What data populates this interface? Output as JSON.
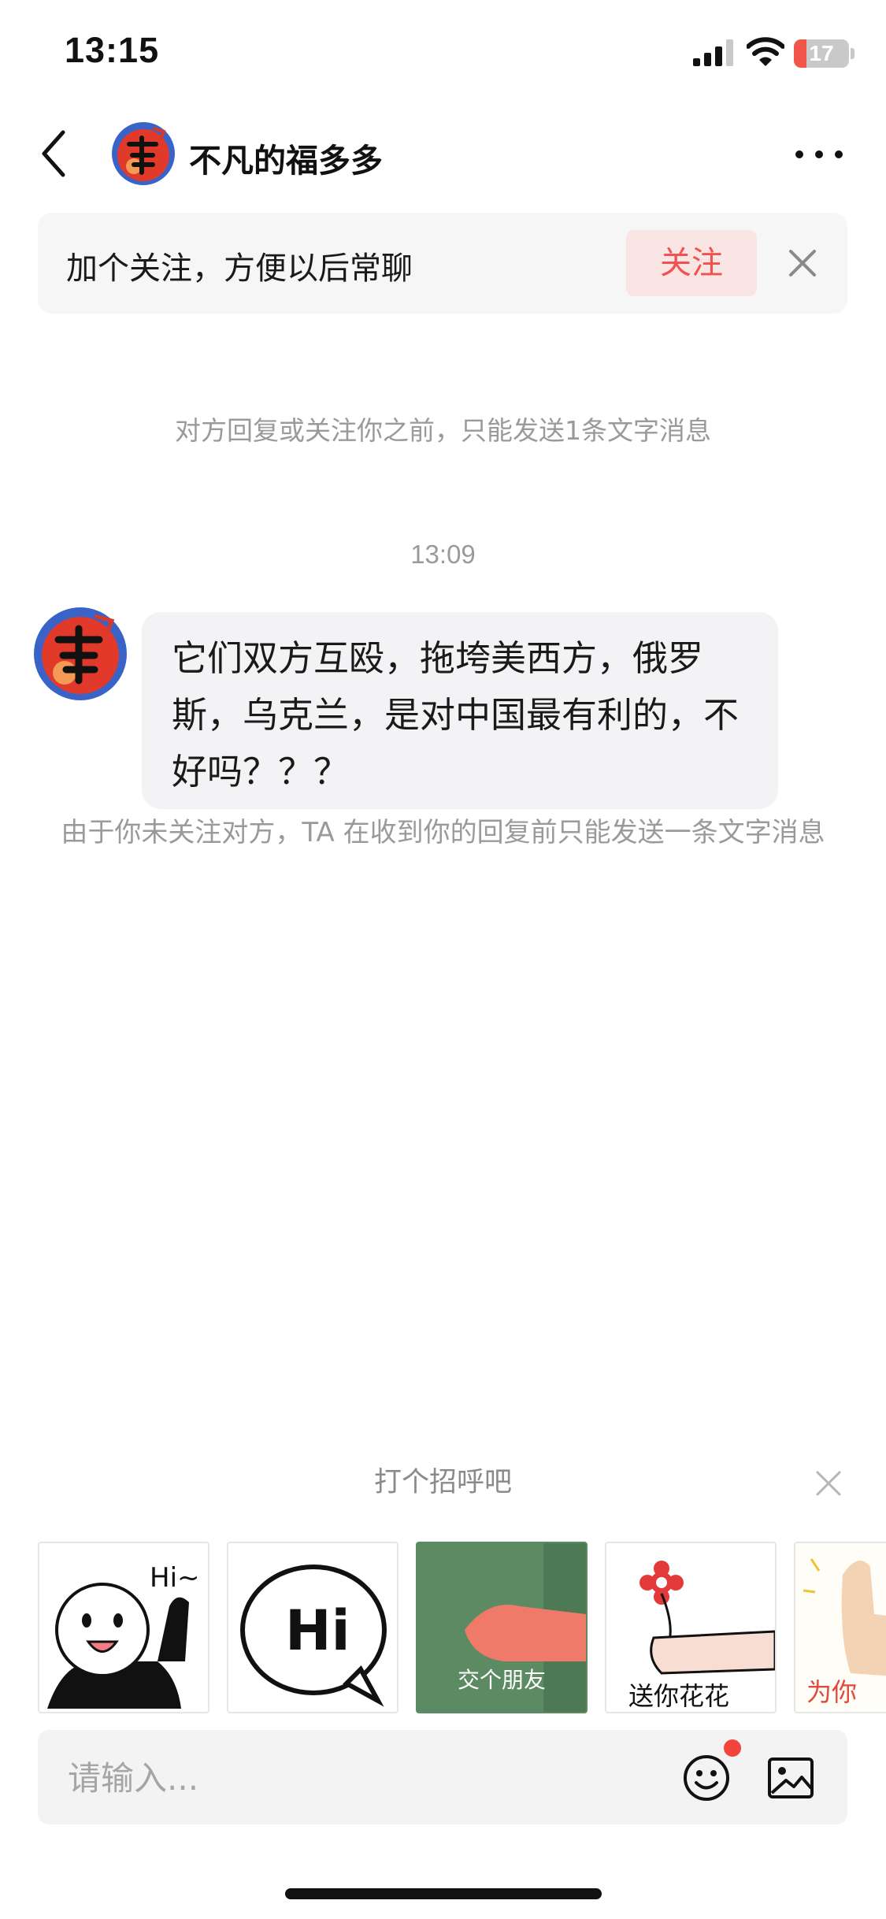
{
  "status_bar": {
    "time": "13:15",
    "battery_level": "17",
    "icons": [
      "signal-icon",
      "wifi-icon",
      "battery-icon"
    ]
  },
  "header": {
    "title": "不凡的福多多",
    "avatar_icon": "fu-character-avatar",
    "back_icon": "chevron-left-icon",
    "more_icon": "more-dots-icon"
  },
  "follow_banner": {
    "text": "加个关注，方便以后常聊",
    "button_label": "关注",
    "close_icon": "close-icon"
  },
  "chat": {
    "system_notice": "对方回复或关注你之前，只能发送1条文字消息",
    "timestamp": "13:09",
    "messages": [
      {
        "sender": "不凡的福多多",
        "text": "它们双方互殴，拖垮美西方，俄罗斯，乌克兰，是对中国最有利的，不好吗？？？"
      }
    ],
    "message_notice": "由于你未关注对方，TA 在收到你的回复前只能发送一条文字消息"
  },
  "greeting": {
    "title": "打个招呼吧",
    "close_icon": "close-icon",
    "stickers": [
      {
        "icon": "panda-hi-sticker",
        "text": "Hi~"
      },
      {
        "icon": "speech-bubble-hi-sticker",
        "text": "Hi"
      },
      {
        "icon": "hand-shake-sticker",
        "text": "交个朋友"
      },
      {
        "icon": "flower-gift-sticker",
        "text": "送你花花"
      },
      {
        "icon": "thumbs-up-sticker",
        "text": "为你"
      }
    ]
  },
  "input": {
    "placeholder": "请输入...",
    "emoji_icon": "emoji-icon",
    "image_icon": "image-icon"
  },
  "colors": {
    "accent": "#f15250",
    "follow_button_bg": "#fae5e5",
    "bubble_bg": "#f3f3f5",
    "muted_text": "#9a9a9a",
    "notification_dot": "#f2443d"
  }
}
